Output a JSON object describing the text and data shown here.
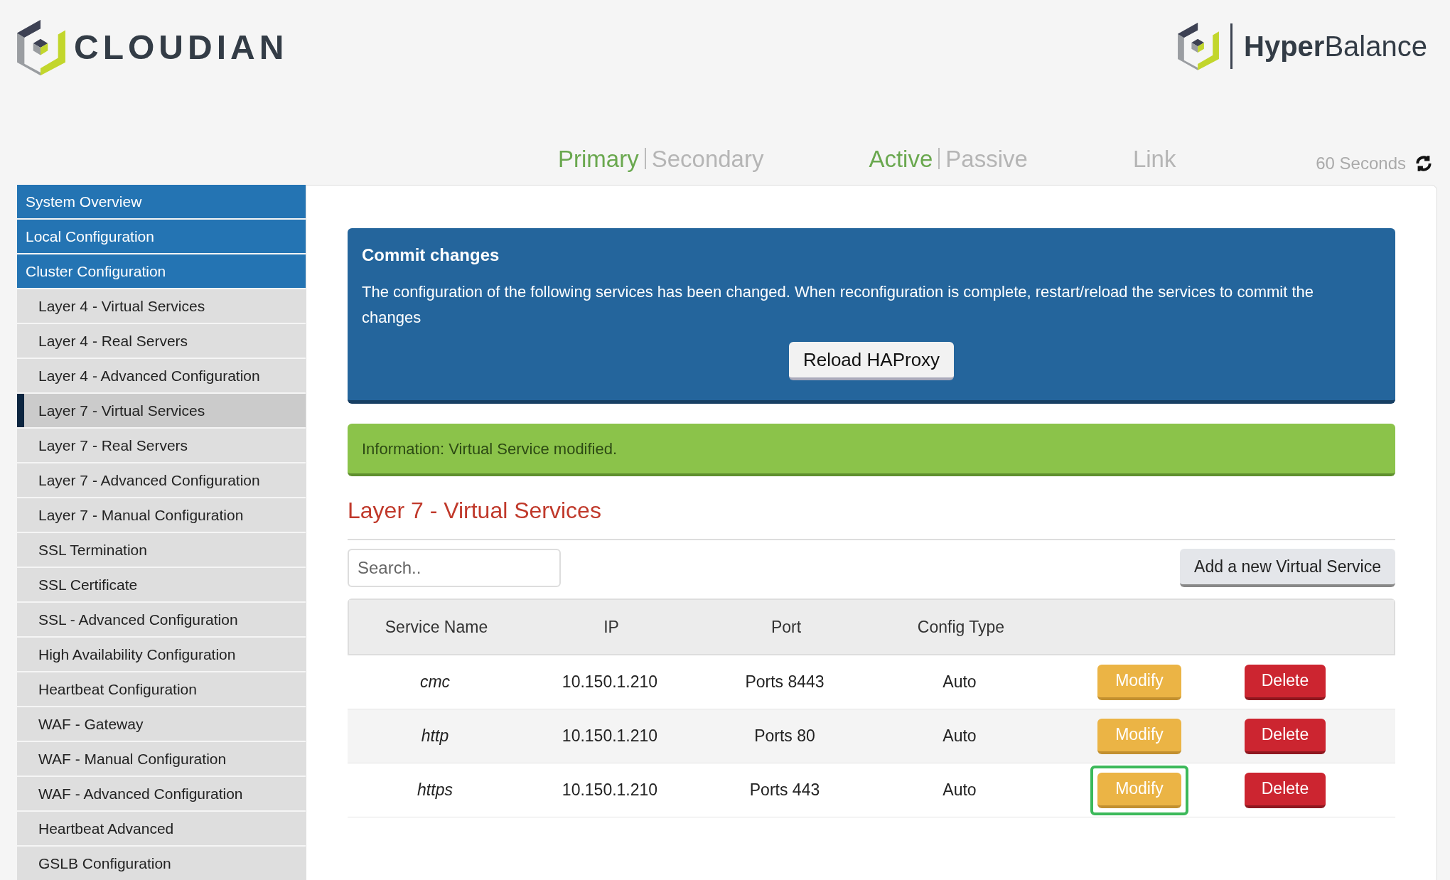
{
  "brand": {
    "left_logo": "CLOUDIAN",
    "right_logo_bold": "Hyper",
    "right_logo_light": "Balance"
  },
  "status": {
    "groups": [
      {
        "items": [
          {
            "label": "Primary",
            "active": true
          },
          {
            "label": "Secondary",
            "active": false
          }
        ]
      },
      {
        "items": [
          {
            "label": "Active",
            "active": true
          },
          {
            "label": "Passive",
            "active": false
          }
        ]
      },
      {
        "items": [
          {
            "label": "Link",
            "active": false
          }
        ]
      }
    ],
    "refresh": "60 Seconds"
  },
  "sidebar": {
    "items": [
      {
        "label": "System Overview",
        "kind": "section",
        "selected": false
      },
      {
        "label": "Local Configuration",
        "kind": "section",
        "selected": false
      },
      {
        "label": "Cluster Configuration",
        "kind": "section",
        "selected": false
      },
      {
        "label": "Layer 4 - Virtual Services",
        "kind": "sub",
        "selected": false
      },
      {
        "label": "Layer 4 - Real Servers",
        "kind": "sub",
        "selected": false
      },
      {
        "label": "Layer 4 - Advanced Configuration",
        "kind": "sub",
        "selected": false
      },
      {
        "label": "Layer 7 - Virtual Services",
        "kind": "sub",
        "selected": true
      },
      {
        "label": "Layer 7 - Real Servers",
        "kind": "sub",
        "selected": false
      },
      {
        "label": "Layer 7 - Advanced Configuration",
        "kind": "sub",
        "selected": false
      },
      {
        "label": "Layer 7 - Manual Configuration",
        "kind": "sub",
        "selected": false
      },
      {
        "label": "SSL Termination",
        "kind": "sub",
        "selected": false
      },
      {
        "label": "SSL Certificate",
        "kind": "sub",
        "selected": false
      },
      {
        "label": "SSL - Advanced Configuration",
        "kind": "sub",
        "selected": false
      },
      {
        "label": "High Availability Configuration",
        "kind": "sub",
        "selected": false
      },
      {
        "label": "Heartbeat Configuration",
        "kind": "sub",
        "selected": false
      },
      {
        "label": "WAF - Gateway",
        "kind": "sub",
        "selected": false
      },
      {
        "label": "WAF - Manual Configuration",
        "kind": "sub",
        "selected": false
      },
      {
        "label": "WAF - Advanced Configuration",
        "kind": "sub",
        "selected": false
      },
      {
        "label": "Heartbeat Advanced",
        "kind": "sub",
        "selected": false
      },
      {
        "label": "GSLB Configuration",
        "kind": "sub",
        "selected": false
      }
    ]
  },
  "commit": {
    "title": "Commit changes",
    "message": "The configuration of the following services has been changed. When reconfiguration is complete, restart/reload the services to commit the changes",
    "button": "Reload HAProxy"
  },
  "info": "Information: Virtual Service modified.",
  "page_title": "Layer 7 - Virtual Services",
  "search": {
    "placeholder": "Search.."
  },
  "add_button": "Add a new Virtual Service",
  "table": {
    "columns": [
      "Service Name",
      "IP",
      "Port",
      "Config Type"
    ],
    "rows": [
      {
        "cells": [
          "cmc",
          "10.150.1.210",
          "Ports 8443",
          "Auto"
        ],
        "modify": "Modify",
        "delete": "Delete",
        "highlighted": false
      },
      {
        "cells": [
          "http",
          "10.150.1.210",
          "Ports 80",
          "Auto"
        ],
        "modify": "Modify",
        "delete": "Delete",
        "highlighted": false
      },
      {
        "cells": [
          "https",
          "10.150.1.210",
          "Ports 443",
          "Auto"
        ],
        "modify": "Modify",
        "delete": "Delete",
        "highlighted": true
      }
    ]
  }
}
